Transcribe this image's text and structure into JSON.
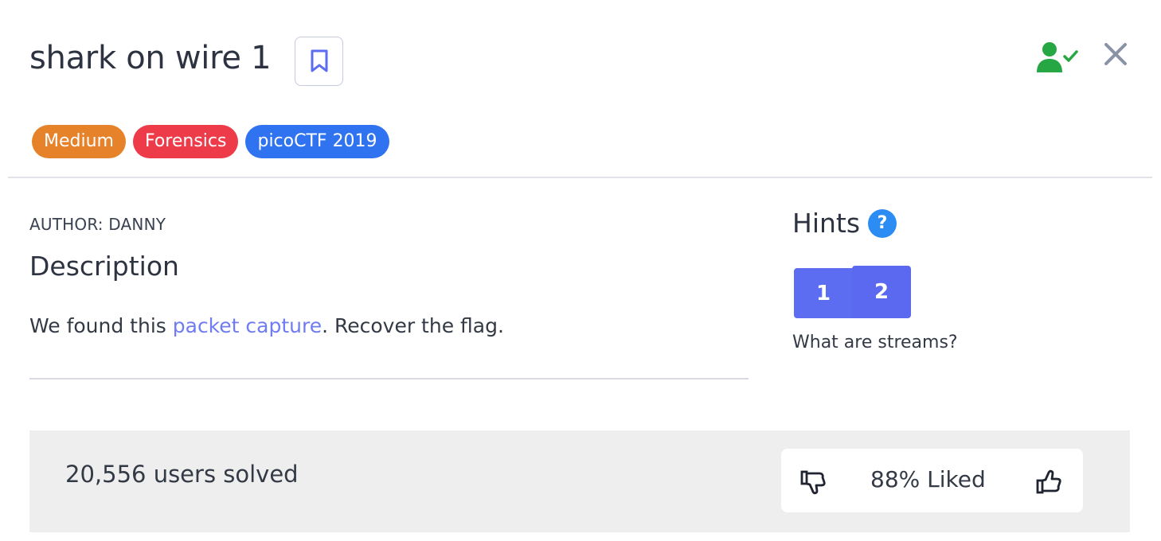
{
  "challenge": {
    "title": "shark on wire 1",
    "tags": [
      {
        "label": "Medium",
        "color": "#e5822a"
      },
      {
        "label": "Forensics",
        "color": "#ee3b4a"
      },
      {
        "label": "picoCTF 2019",
        "color": "#2f73f0"
      }
    ],
    "author": "AUTHOR: DANNY",
    "description_heading": "Description",
    "description_before": "We found this ",
    "description_link": "packet capture",
    "description_after": ". Recover the flag."
  },
  "hints": {
    "heading": "Hints",
    "help_glyph": "?",
    "tabs": [
      "1",
      "2"
    ],
    "active_text": "What are streams?"
  },
  "stats": {
    "solved_text": "20,556 users solved",
    "liked_text": "88% Liked"
  },
  "icons": {
    "bookmark": "bookmark-icon",
    "solved_user": "user-check-icon",
    "close": "close-icon",
    "dislike": "thumbs-down-icon",
    "like": "thumbs-up-icon"
  },
  "colors": {
    "accent": "#5d6df2",
    "link": "#6f7cf2",
    "success": "#27a744",
    "help": "#2b8cf3"
  }
}
